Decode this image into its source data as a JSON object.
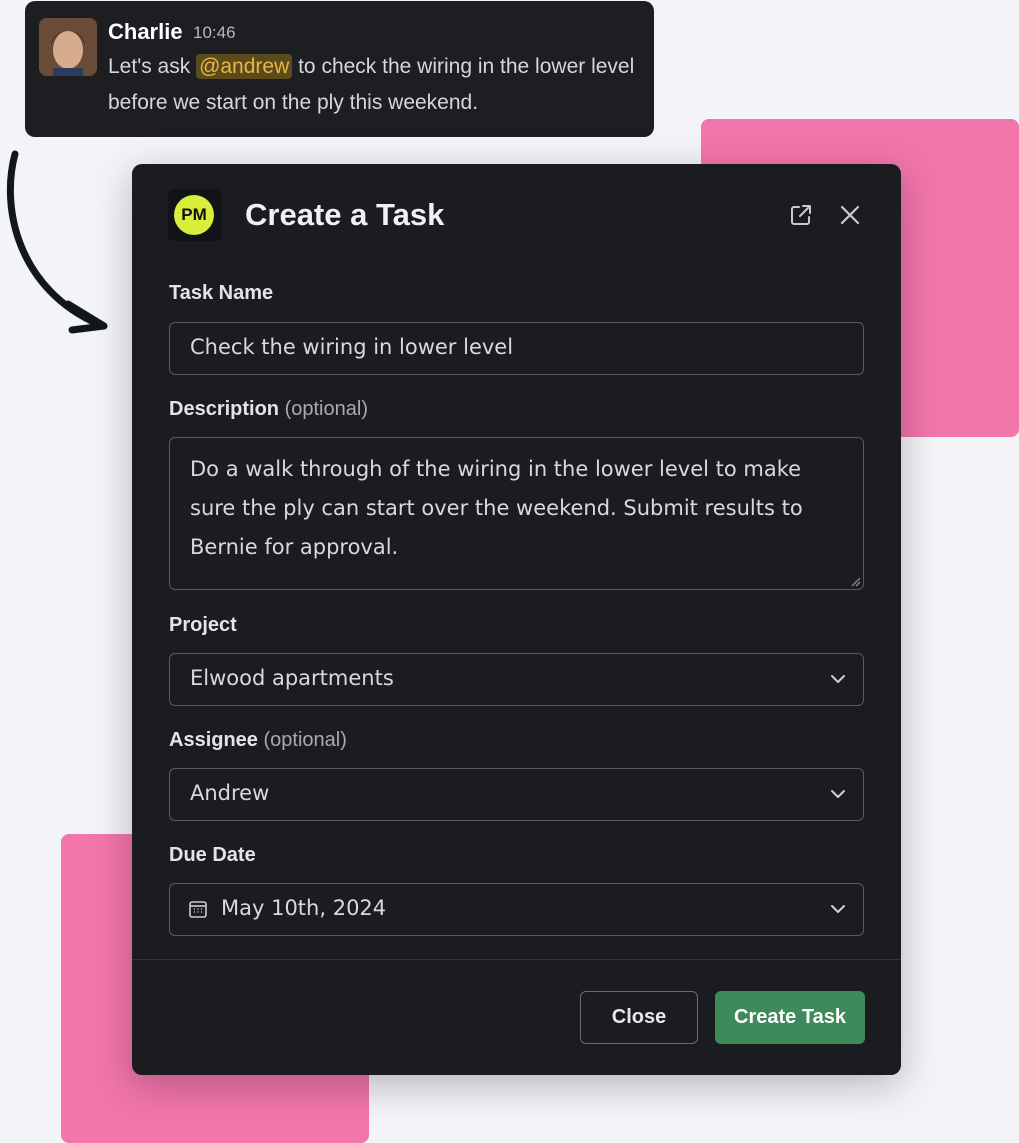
{
  "message": {
    "author": "Charlie",
    "time": "10:46",
    "text_before": "Let's ask ",
    "mention": "@andrew",
    "text_after": " to check the wiring in the lower level before we start on the ply this weekend."
  },
  "modal": {
    "logo_text": "PM",
    "title": "Create a Task",
    "fields": {
      "task_name": {
        "label": "Task Name",
        "value": "Check the wiring in lower level"
      },
      "description": {
        "label": "Description",
        "optional": "(optional)",
        "value": "Do a walk through of the wiring in the lower level to make sure the ply can start over the weekend. Submit results to Bernie for approval."
      },
      "project": {
        "label": "Project",
        "value": "Elwood apartments"
      },
      "assignee": {
        "label": "Assignee",
        "optional": "(optional)",
        "value": "Andrew"
      },
      "due_date": {
        "label": "Due Date",
        "value": "May 10th, 2024"
      }
    },
    "buttons": {
      "close": "Close",
      "create": "Create Task"
    }
  },
  "colors": {
    "pink": "#f275ac",
    "modal_bg": "#1b1c1f",
    "accent_green": "#3e8a5b",
    "mention_text": "#e6b844",
    "logo": "#d7ee3a"
  },
  "icons": [
    "external-link-icon",
    "close-icon",
    "chevron-down-icon",
    "calendar-icon",
    "curved-arrow-icon"
  ]
}
